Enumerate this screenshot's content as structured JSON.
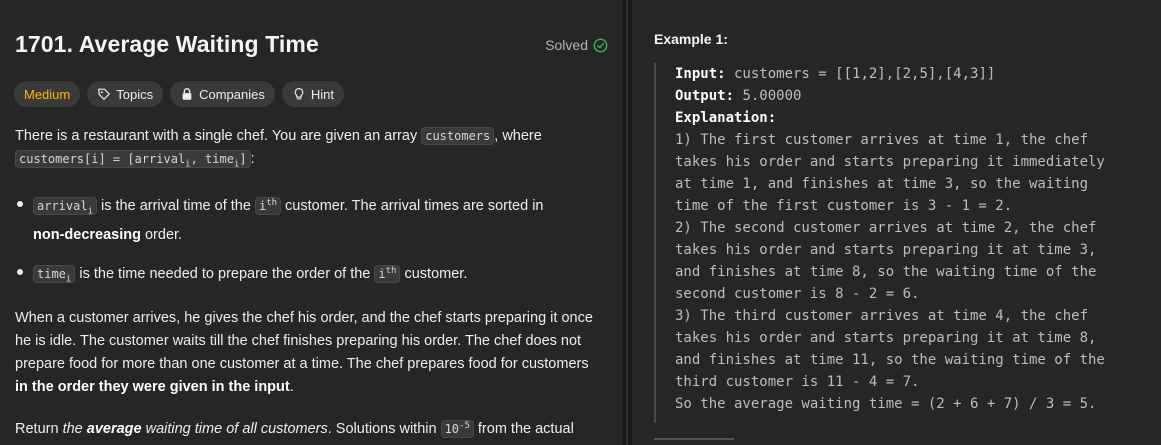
{
  "problem": {
    "title": "1701. Average Waiting Time",
    "solved_label": "Solved",
    "difficulty": "Medium",
    "tags": [
      "Topics",
      "Companies",
      "Hint"
    ]
  },
  "description": {
    "intro_1": "There is a restaurant with a single chef. You are given an array ",
    "intro_code_1": "customers",
    "intro_2": ", where ",
    "intro_code_2": "customers[i] = [arrival",
    "intro_code_2_sub": "i",
    "intro_code_2b": ", time",
    "intro_code_2b_sub": "i",
    "intro_code_2c": "]",
    "intro_3": ":",
    "bullet1_code": "arrival",
    "bullet1_code_sub": "i",
    "bullet1_a": " is the arrival time of the ",
    "bullet1_sup_base": "i",
    "bullet1_sup": "th",
    "bullet1_b": " customer. The arrival times are sorted in ",
    "bullet1_bold": "non-decreasing",
    "bullet1_c": " order.",
    "bullet2_code": "time",
    "bullet2_code_sub": "i",
    "bullet2_a": " is the time needed to prepare the order of the ",
    "bullet2_sup_base": "i",
    "bullet2_sup": "th",
    "bullet2_b": " customer.",
    "para2_a": "When a customer arrives, he gives the chef his order, and the chef starts preparing it once he is idle. The customer waits till the chef finishes preparing his order. The chef does not prepare food for more than one customer at a time. The chef prepares food for customers ",
    "para2_bold": "in the order they were given in the input",
    "para2_b": ".",
    "para3_a": "Return ",
    "para3_italic1": "the ",
    "para3_bold": "average",
    "para3_italic2": " waiting time of all customers",
    "para3_b": ". Solutions within ",
    "para3_code_base": "10",
    "para3_code_sup": "-5",
    "para3_c": " from the actual answer are considered accepted."
  },
  "example": {
    "title": "Example 1:",
    "input_label": "Input:",
    "input_value": " customers = [[1,2],[2,5],[4,3]]",
    "output_label": "Output:",
    "output_value": " 5.00000",
    "explanation_label": "Explanation:",
    "lines": [
      "1) The first customer arrives at time 1, the chef",
      "takes his order and starts preparing it immediately",
      "at time 1, and finishes at time 3, so the waiting",
      "time of the first customer is 3 - 1 = 2.",
      "2) The second customer arrives at time 2, the chef",
      "takes his order and starts preparing it at time 3,",
      "and finishes at time 8, so the waiting time of the",
      "second customer is 8 - 2 = 6.",
      "3) The third customer arrives at time 4, the chef",
      "takes his order and starts preparing it at time 8,",
      "and finishes at time 11, so the waiting time of the",
      "third customer is 11 - 4 = 7.",
      "So the average waiting time = (2 + 6 + 7) / 3 = 5."
    ]
  },
  "colors": {
    "difficulty_medium": "#ffb800",
    "solved_check": "#2cbb5d",
    "panel_bg": "#262626",
    "page_bg": "#1a1a1a"
  },
  "icons": [
    "check-circle-icon",
    "tag-icon",
    "lock-icon",
    "lightbulb-icon"
  ]
}
